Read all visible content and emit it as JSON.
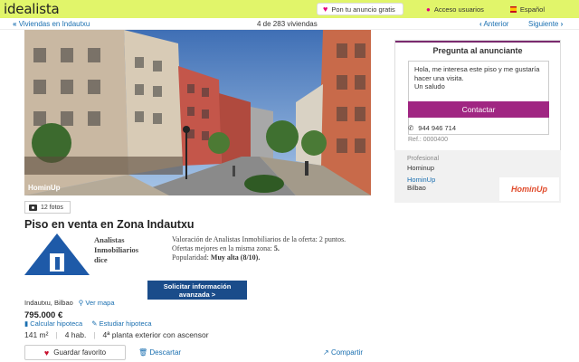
{
  "header": {
    "logo": "idealista",
    "announce_label": "Pon tu anuncio gratis",
    "access_label": "Acceso usuarios",
    "language_label": "Español"
  },
  "subnav": {
    "back_label": "Viviendas en Indautxu",
    "count_label": "4 de 283 viviendas",
    "prev_label": "Anterior",
    "next_label": "Siguiente"
  },
  "listing": {
    "watermark": "HominUp",
    "photo_count": "12 fotos",
    "title": "Piso en venta en Zona Indautxu",
    "agency_name_lines": [
      "Analistas",
      "Inmobiliarios",
      "dice"
    ],
    "rating_lines": [
      "Valoración de Analistas Inmobiliarios de la oferta: 2 puntos.",
      "Ofertas mejores en la misma zona: 5.",
      "Popularidad: Muy alta (8/10)."
    ],
    "rating_highlights": [
      "5.",
      "Muy alta (8/10)."
    ],
    "solicitar_label": "Solicitar información avanzada >",
    "location": "Indautxu, Bilbao",
    "map_label": "Ver mapa",
    "price": "795.000 €",
    "calc_label": "Calcular hipoteca",
    "study_label": "Estudiar hipoteca",
    "features": [
      "141 m²",
      "4 hab.",
      "4ª planta exterior con ascensor"
    ],
    "fav_label": "Guardar favorito",
    "discard_label": "Descartar",
    "share_label": "Compartir"
  },
  "contact": {
    "title": "Pregunta al anunciante",
    "message": "Hola, me interesa este piso y me gustaría hacer una visita.\nUn saludo",
    "button_label": "Contactar",
    "phone": "944 946 714",
    "ref": "Ref.: 0000400"
  },
  "professional": {
    "label": "Profesional",
    "name": "Hominup",
    "link": "HominUp",
    "city": "Bilbao",
    "logo_text": "HominUp"
  },
  "colors": {
    "brand_yellow": "#e1f56a",
    "accent_magenta": "#a02682",
    "link_blue": "#1a6fb0",
    "cta_navy": "#1a4c8a"
  },
  "icons": [
    "heart-icon",
    "user-icon",
    "flag-icon",
    "chevron-left-icon",
    "chevron-right-icon",
    "camera-icon",
    "pin-icon",
    "chart-icon",
    "pencil-icon",
    "trash-icon",
    "share-icon",
    "phone-icon"
  ]
}
